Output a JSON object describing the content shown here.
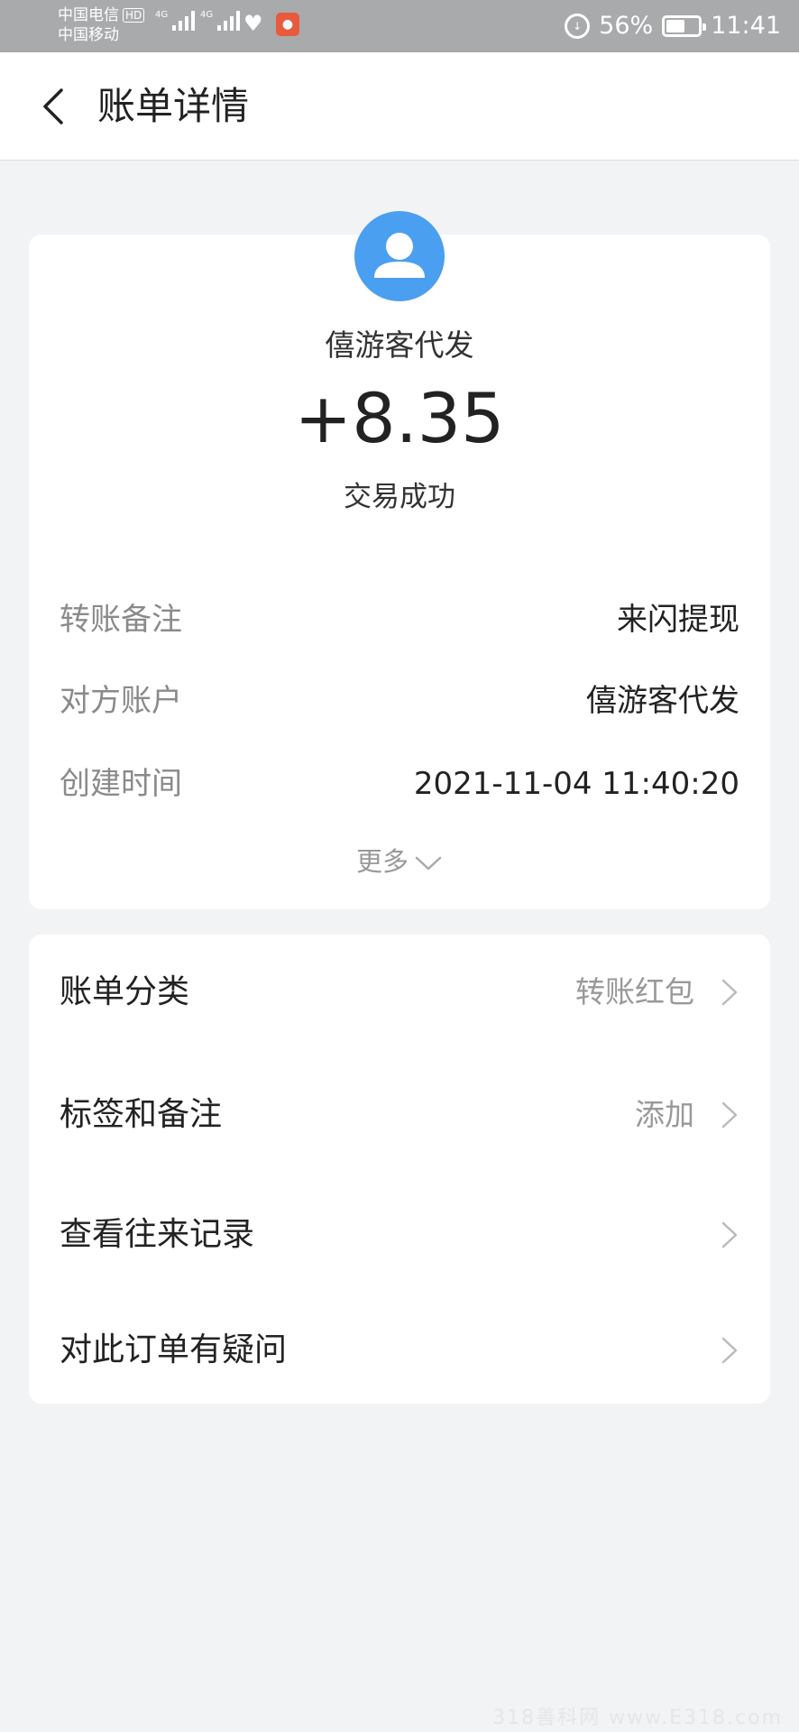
{
  "status_bar": {
    "carrier1": "中国电信",
    "hd": "HD",
    "carrier2": "中国移动",
    "net1": "4G",
    "net2": "4G",
    "battery": "56%",
    "time": "11:41"
  },
  "nav": {
    "title": "账单详情"
  },
  "summary": {
    "payer": "僖游客代发",
    "amount": "+8.35",
    "status": "交易成功"
  },
  "details": [
    {
      "label": "转账备注",
      "value": "来闪提现"
    },
    {
      "label": "对方账户",
      "value": "僖游客代发"
    },
    {
      "label": "创建时间",
      "value": "2021-11-04 11:40:20"
    }
  ],
  "more_label": "更多",
  "actions": [
    {
      "label": "账单分类",
      "value": "转账红包"
    },
    {
      "label": "标签和备注",
      "value": "添加"
    },
    {
      "label": "查看往来记录",
      "value": ""
    },
    {
      "label": "对此订单有疑问",
      "value": ""
    }
  ],
  "watermark": "318善科网 www.E318.com",
  "colors": {
    "status_bar_bg": "#a9aaac",
    "avatar_blue": "#4a9ff0",
    "page_bg": "#f2f3f5"
  }
}
